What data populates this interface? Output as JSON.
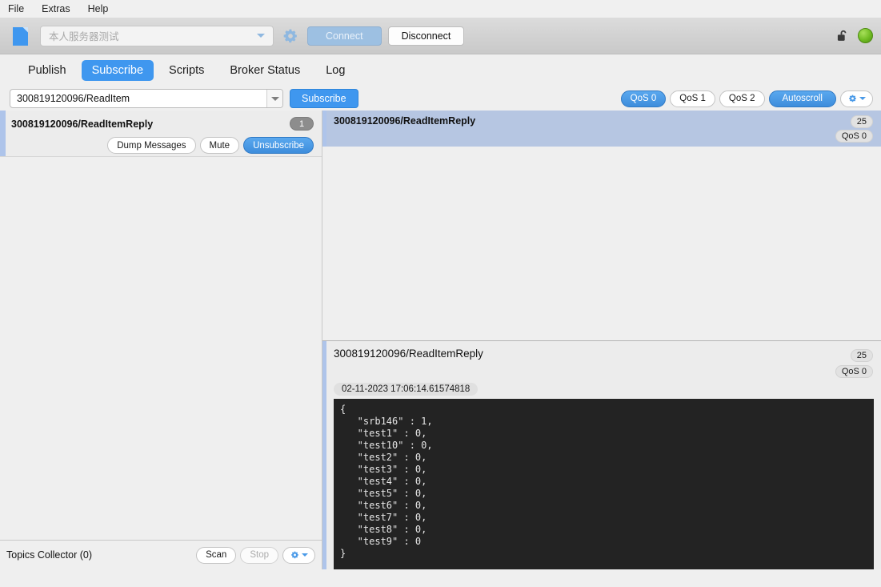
{
  "menu": {
    "items": [
      {
        "label": "File"
      },
      {
        "label": "Extras"
      },
      {
        "label": "Help"
      }
    ]
  },
  "connection_toolbar": {
    "doc_icon": "new-file-icon",
    "broker_placeholder": "本人服务器测试",
    "broker_value": "",
    "settings_icon": "gear-icon",
    "connect_label": "Connect",
    "disconnect_label": "Disconnect",
    "lock_icon": "unlocked-padlock-icon",
    "status_icon": "connected-status-dot",
    "status_color": "#6fbb22",
    "connect_enabled": false
  },
  "tabs": {
    "items": [
      {
        "label": "Publish",
        "active": false
      },
      {
        "label": "Subscribe",
        "active": true
      },
      {
        "label": "Scripts",
        "active": false
      },
      {
        "label": "Broker Status",
        "active": false
      },
      {
        "label": "Log",
        "active": false
      }
    ],
    "accent_color": "#3f97ef"
  },
  "subscribe_bar": {
    "topic_value": "300819120096/ReadItem",
    "topic_placeholder": "",
    "subscribe_label": "Subscribe",
    "qos_buttons": [
      {
        "label": "QoS 0",
        "active": true
      },
      {
        "label": "QoS 1",
        "active": false
      },
      {
        "label": "QoS 2",
        "active": false
      }
    ],
    "autoscroll_label": "Autoscroll",
    "autoscroll_active": true,
    "options_icon": "gear-dropdown-icon"
  },
  "subscriptions": {
    "items": [
      {
        "topic": "300819120096/ReadItemReply",
        "count": "1",
        "dump_label": "Dump Messages",
        "mute_label": "Mute",
        "unsubscribe_label": "Unsubscribe"
      }
    ]
  },
  "topics_collector": {
    "title": "Topics Collector (0)",
    "scan_label": "Scan",
    "stop_label": "Stop",
    "stop_enabled": false,
    "options_icon": "gear-dropdown-icon"
  },
  "message_list": {
    "rows": [
      {
        "topic": "300819120096/ReadItemReply",
        "size": "25",
        "qos": "QoS 0",
        "selected": true
      }
    ]
  },
  "message_detail": {
    "topic": "300819120096/ReadItemReply",
    "size": "25",
    "qos": "QoS 0",
    "timestamp": "02-11-2023  17:06:14.61574818",
    "payload": "{\n   \"srb146\" : 1,\n   \"test1\" : 0,\n   \"test10\" : 0,\n   \"test2\" : 0,\n   \"test3\" : 0,\n   \"test4\" : 0,\n   \"test5\" : 0,\n   \"test6\" : 0,\n   \"test7\" : 0,\n   \"test8\" : 0,\n   \"test9\" : 0\n}"
  }
}
